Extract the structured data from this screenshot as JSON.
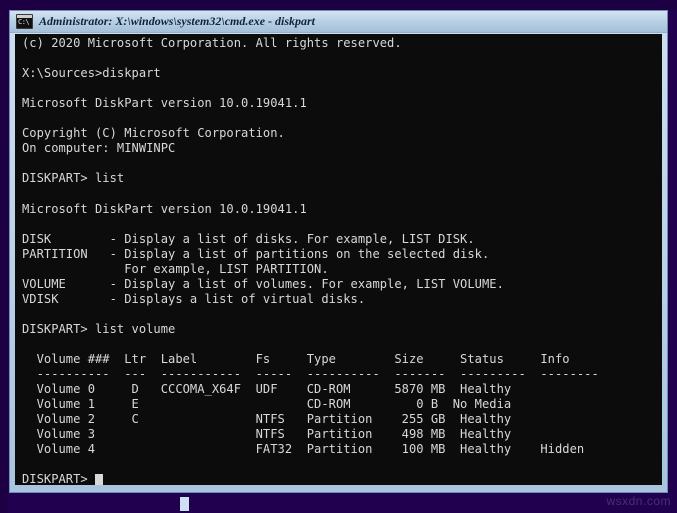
{
  "window": {
    "title": "Administrator: X:\\windows\\system32\\cmd.exe - diskpart",
    "icon_name": "console-icon",
    "icon_glyph": "C:\\",
    "titlebar_color": "#b6cee3",
    "console_bg": "#0c0c0c",
    "console_fg": "#d8d8d8",
    "desktop_color": "#220050"
  },
  "console": {
    "lines": [
      "(c) 2020 Microsoft Corporation. All rights reserved.",
      "",
      "X:\\Sources>diskpart",
      "",
      "Microsoft DiskPart version 10.0.19041.1",
      "",
      "Copyright (C) Microsoft Corporation.",
      "On computer: MINWINPC",
      "",
      "DISKPART> list",
      "",
      "Microsoft DiskPart version 10.0.19041.1",
      "",
      "DISK        - Display a list of disks. For example, LIST DISK.",
      "PARTITION   - Display a list of partitions on the selected disk.",
      "              For example, LIST PARTITION.",
      "VOLUME      - Display a list of volumes. For example, LIST VOLUME.",
      "VDISK       - Displays a list of virtual disks.",
      "",
      "DISKPART> list volume",
      "",
      "  Volume ###  Ltr  Label        Fs     Type        Size     Status     Info",
      "  ----------  ---  -----------  -----  ----------  -------  ---------  --------",
      "  Volume 0     D   CCCOMA_X64F  UDF    CD-ROM      5870 MB  Healthy",
      "  Volume 1     E                       CD-ROM         0 B  No Media",
      "  Volume 2     C                NTFS   Partition    255 GB  Healthy",
      "  Volume 3                      NTFS   Partition    498 MB  Healthy",
      "  Volume 4                      FAT32  Partition    100 MB  Healthy    Hidden",
      ""
    ],
    "prompt": "DISKPART> ",
    "cursor_visible": true
  },
  "volume_table": {
    "headers": [
      "Volume ###",
      "Ltr",
      "Label",
      "Fs",
      "Type",
      "Size",
      "Status",
      "Info"
    ],
    "rows": [
      {
        "volume": "Volume 0",
        "ltr": "D",
        "label": "CCCOMA_X64F",
        "fs": "UDF",
        "type": "CD-ROM",
        "size": "5870 MB",
        "status": "Healthy",
        "info": ""
      },
      {
        "volume": "Volume 1",
        "ltr": "E",
        "label": "",
        "fs": "",
        "type": "CD-ROM",
        "size": "0 B",
        "status": "No Media",
        "info": ""
      },
      {
        "volume": "Volume 2",
        "ltr": "C",
        "label": "",
        "fs": "NTFS",
        "type": "Partition",
        "size": "255 GB",
        "status": "Healthy",
        "info": ""
      },
      {
        "volume": "Volume 3",
        "ltr": "",
        "label": "",
        "fs": "NTFS",
        "type": "Partition",
        "size": "498 MB",
        "status": "Healthy",
        "info": ""
      },
      {
        "volume": "Volume 4",
        "ltr": "",
        "label": "",
        "fs": "FAT32",
        "type": "Partition",
        "size": "100 MB",
        "status": "Healthy",
        "info": "Hidden"
      }
    ]
  },
  "desktop": {
    "watermark": "wsxdn.com",
    "taskbar_item_name": "taskbar-item"
  }
}
